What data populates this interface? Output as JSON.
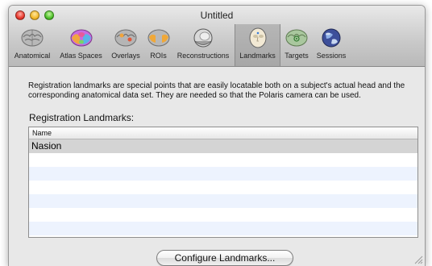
{
  "window": {
    "title": "Untitled"
  },
  "toolbar": {
    "items": [
      {
        "label": "Anatomical",
        "icon": "brain-gray-icon"
      },
      {
        "label": "Atlas Spaces",
        "icon": "brain-colored-icon"
      },
      {
        "label": "Overlays",
        "icon": "brain-overlay-icon"
      },
      {
        "label": "ROIs",
        "icon": "brain-roi-icon"
      },
      {
        "label": "Reconstructions",
        "icon": "head-reconstruction-icon"
      },
      {
        "label": "Landmarks",
        "icon": "head-landmarks-icon"
      },
      {
        "label": "Targets",
        "icon": "brain-targets-icon"
      },
      {
        "label": "Sessions",
        "icon": "sessions-globe-icon"
      }
    ],
    "selected": "Landmarks"
  },
  "content": {
    "description": "Registration landmarks are special points that are easily locatable both on a subject's actual head and the corresponding anatomical data set. They are needed so that the Polaris camera can be used.",
    "section_label": "Registration Landmarks:",
    "table": {
      "columns": [
        "Name"
      ],
      "rows": [
        [
          "Nasion"
        ]
      ]
    },
    "configure_button": "Configure Landmarks..."
  }
}
